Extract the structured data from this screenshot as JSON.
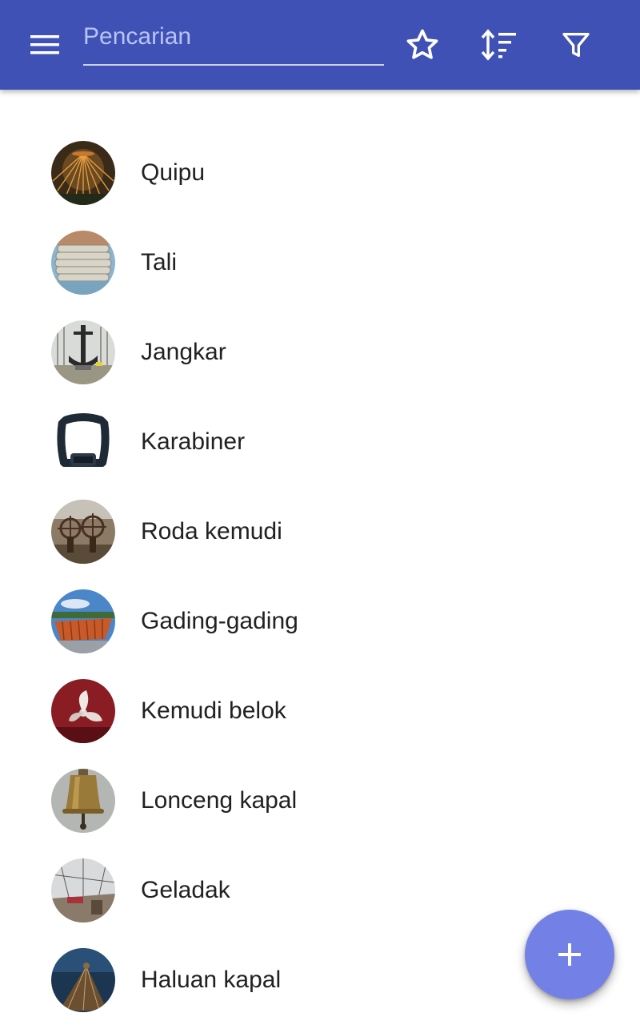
{
  "app_bar": {
    "background_color": "#3f51b5",
    "menu_icon": "menu-icon",
    "search": {
      "placeholder": "Pencarian",
      "value": ""
    },
    "actions": [
      {
        "icon": "star-outline-icon"
      },
      {
        "icon": "sort-icon"
      },
      {
        "icon": "filter-icon"
      }
    ]
  },
  "items": [
    {
      "label": "Quipu",
      "thumbnail": "quipu-thumbnail"
    },
    {
      "label": "Tali",
      "thumbnail": "rope-thumbnail"
    },
    {
      "label": "Jangkar",
      "thumbnail": "anchor-thumbnail"
    },
    {
      "label": "Karabiner",
      "thumbnail": "carabiner-thumbnail"
    },
    {
      "label": "Roda kemudi",
      "thumbnail": "ship-wheel-thumbnail"
    },
    {
      "label": "Gading-gading",
      "thumbnail": "ship-frame-thumbnail"
    },
    {
      "label": "Kemudi belok",
      "thumbnail": "rudder-thumbnail"
    },
    {
      "label": "Lonceng kapal",
      "thumbnail": "ship-bell-thumbnail"
    },
    {
      "label": "Geladak",
      "thumbnail": "deck-thumbnail"
    },
    {
      "label": "Haluan kapal",
      "thumbnail": "bow-thumbnail"
    }
  ],
  "fab": {
    "icon": "plus-icon",
    "color": "#7381e6"
  }
}
